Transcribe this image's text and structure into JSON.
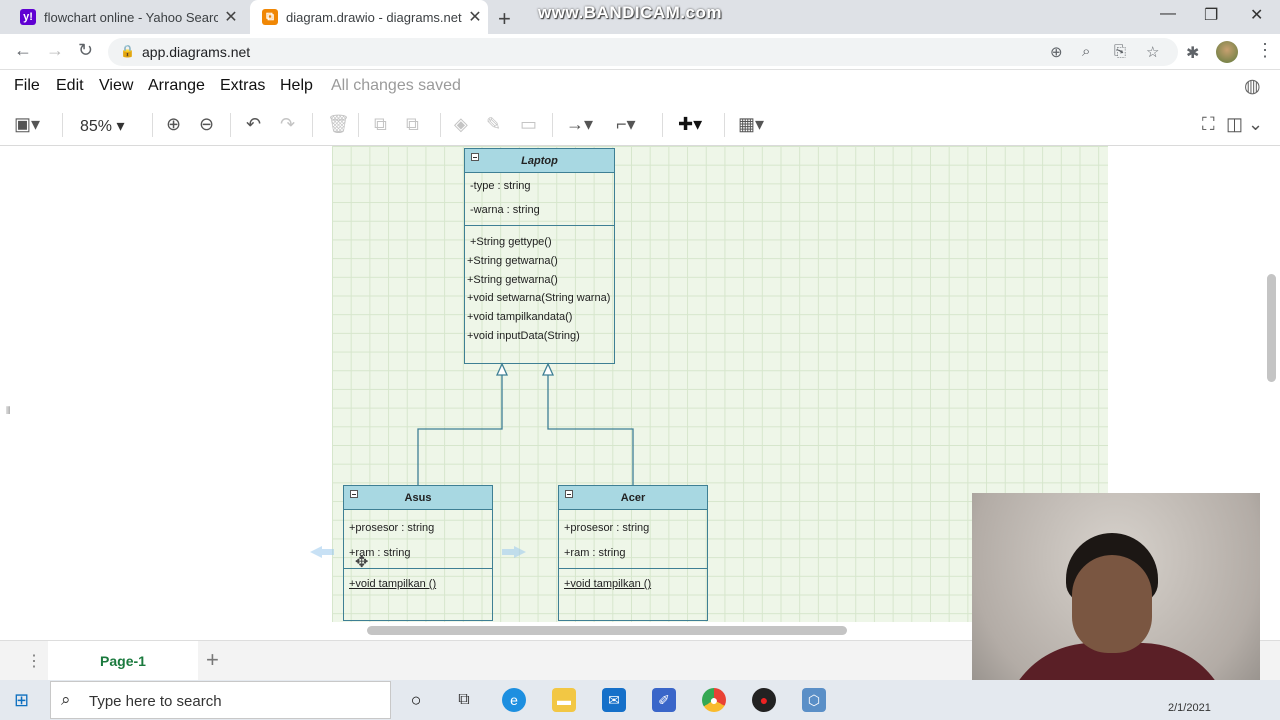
{
  "browser": {
    "tabs": [
      {
        "title": "flowchart online - Yahoo Search",
        "icon": "yahoo-icon"
      },
      {
        "title": "diagram.drawio - diagrams.net",
        "icon": "drawio-icon"
      }
    ],
    "watermark": "www.BANDICAM.com",
    "url": "app.diagrams.net"
  },
  "drawio": {
    "menu": [
      "File",
      "Edit",
      "View",
      "Arrange",
      "Extras",
      "Help"
    ],
    "status": "All changes saved",
    "zoom": "85%",
    "page_tab": "Page-1"
  },
  "diagram": {
    "laptop": {
      "name": "Laptop",
      "attributes": [
        "-type : string",
        "-warna : string"
      ],
      "methods": [
        "+String gettype()",
        "+String getwarna()",
        "+String getwarna()",
        "+void setwarna(String warna)",
        "+void tampilkandata()",
        "+void inputData(String)"
      ]
    },
    "asus": {
      "name": "Asus",
      "attributes": [
        "+prosesor : string",
        "+ram : string"
      ],
      "methods": [
        "+void tampilkan ()"
      ]
    },
    "acer": {
      "name": "Acer",
      "attributes": [
        "+prosesor : string",
        "+ram : string"
      ],
      "methods": [
        "+void tampilkan ()"
      ]
    }
  },
  "taskbar": {
    "search_placeholder": "Type here to search",
    "date": "2/1/2021"
  },
  "colors": {
    "class_header": "#a8d8e2",
    "class_border": "#3e7f94",
    "canvas_grid": "#eef6e8",
    "page_tab_text": "#1b7a3e"
  }
}
